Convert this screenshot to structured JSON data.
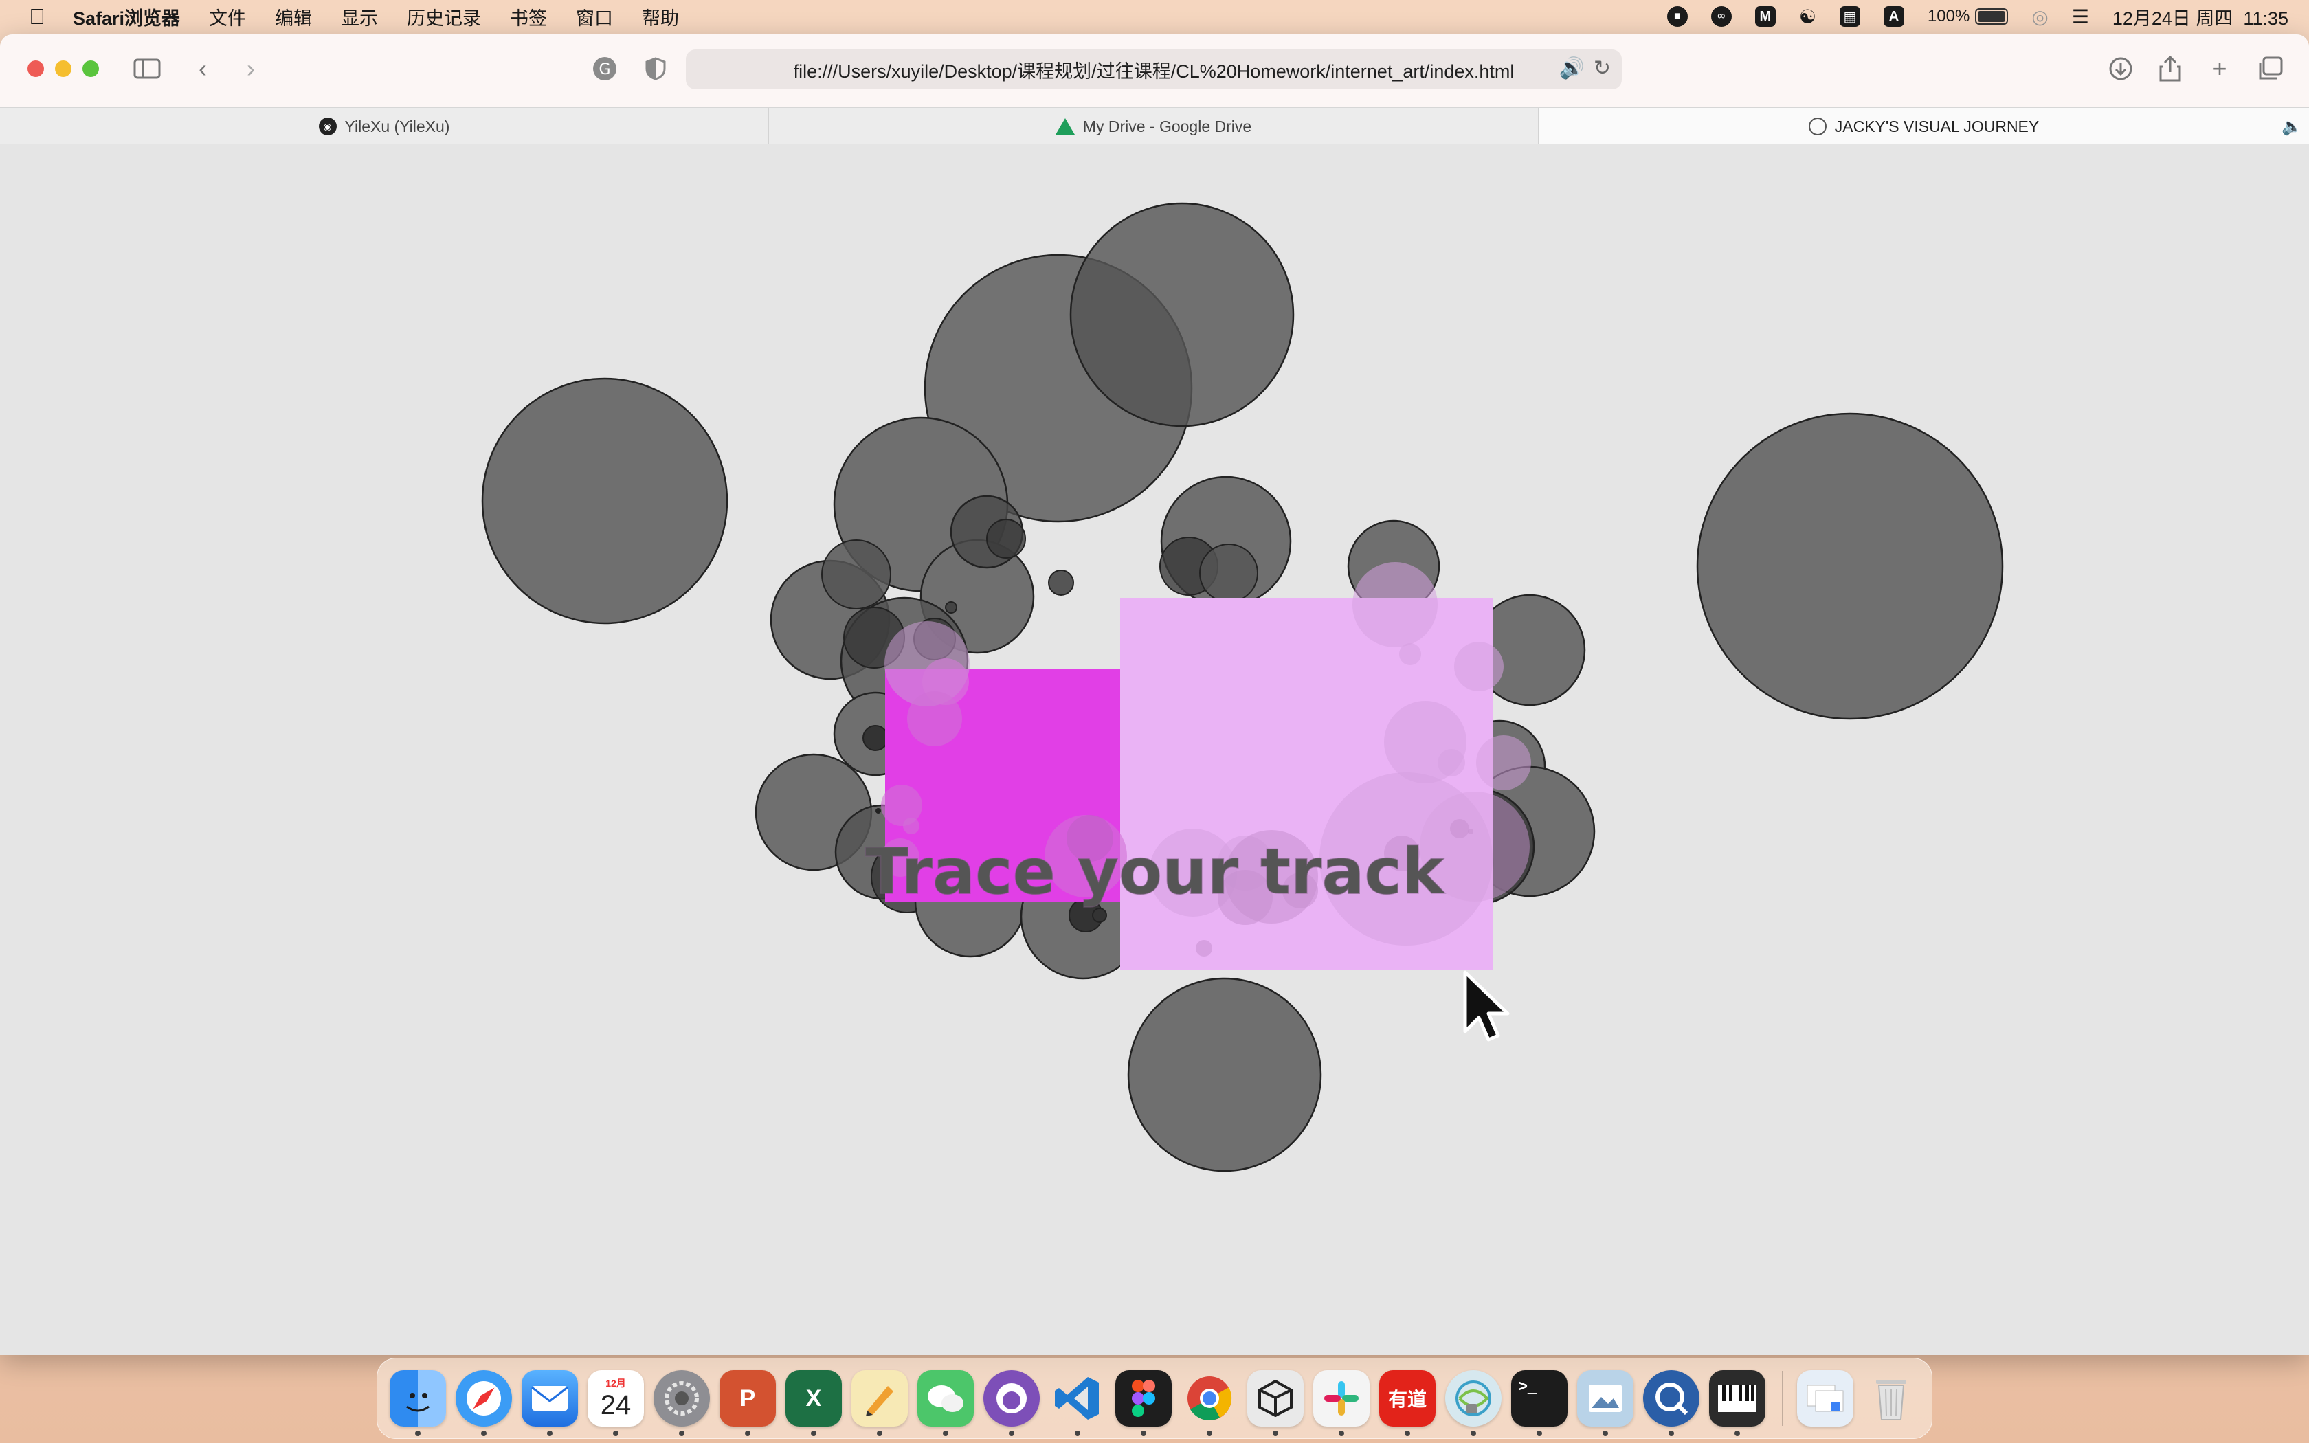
{
  "menubar": {
    "app_name": "Safari浏览器",
    "items": [
      "文件",
      "编辑",
      "显示",
      "历史记录",
      "书签",
      "窗口",
      "帮助"
    ],
    "battery": "100%",
    "datetime": "12月24日 周四  11:35",
    "status_icons": [
      "stop-record-icon",
      "creative-cloud-icon",
      "m-app-icon",
      "translate-icon",
      "grid-app-icon",
      "input-source-icon",
      "battery-icon",
      "siri-icon",
      "control-center-icon"
    ]
  },
  "browser": {
    "url": "file:///Users/xuyile/Desktop/课程规划/过往课程/CL%20Homework/internet_art/index.html",
    "tabs": [
      {
        "title": "YileXu (YileXu)",
        "icon": "github-icon",
        "active": false
      },
      {
        "title": "My Drive - Google Drive",
        "icon": "google-drive-icon",
        "active": false
      },
      {
        "title": "JACKY'S VISUAL JOURNEY",
        "icon": "compass-icon",
        "active": true
      }
    ]
  },
  "page": {
    "headline": "Trace your track",
    "colors": {
      "background": "#e5e5e5",
      "circle_fill": "#6f6f6f",
      "rect_magenta": "#e13fe6",
      "rect_pink": "#eab3f5",
      "headline": "#555555"
    }
  },
  "dock": {
    "apps": [
      {
        "name": "finder-icon",
        "color": "#2f8bf0"
      },
      {
        "name": "safari-icon",
        "color": "#3b9cf5"
      },
      {
        "name": "mail-icon",
        "color": "#3a8ef7"
      },
      {
        "name": "calendar-icon",
        "color": "#ffffff",
        "month": "12月",
        "day": "24"
      },
      {
        "name": "system-preferences-icon",
        "color": "#8e8e93"
      },
      {
        "name": "powerpoint-icon",
        "color": "#d35230",
        "glyph": "P"
      },
      {
        "name": "excel-icon",
        "color": "#1d7044",
        "glyph": "X"
      },
      {
        "name": "notes-pencil-icon",
        "color": "#f7e9b5"
      },
      {
        "name": "wechat-icon",
        "color": "#4cc66a"
      },
      {
        "name": "github-desktop-icon",
        "color": "#7d4fb8"
      },
      {
        "name": "vscode-icon",
        "color": "#1f7bd1"
      },
      {
        "name": "figma-icon",
        "color": "#1e1e1e"
      },
      {
        "name": "chrome-icon",
        "color": "#f0f0f0"
      },
      {
        "name": "unity-icon",
        "color": "#e9e9e9"
      },
      {
        "name": "slack-icon",
        "color": "#f4f4f4"
      },
      {
        "name": "youdao-icon",
        "color": "#e2231a",
        "glyph": "有道"
      },
      {
        "name": "network-lock-icon",
        "color": "#d6e8ef"
      },
      {
        "name": "terminal-icon",
        "color": "#1c1c1c",
        "glyph": ">_"
      },
      {
        "name": "preview-icon",
        "color": "#b9d3e8"
      },
      {
        "name": "quicktime-icon",
        "color": "#2a5ea7"
      },
      {
        "name": "piano-icon",
        "color": "#2b2b2b"
      },
      {
        "name": "downloads-stack-icon",
        "color": "#e6eef7"
      },
      {
        "name": "trash-icon",
        "color": "#dcdcdc"
      }
    ]
  }
}
